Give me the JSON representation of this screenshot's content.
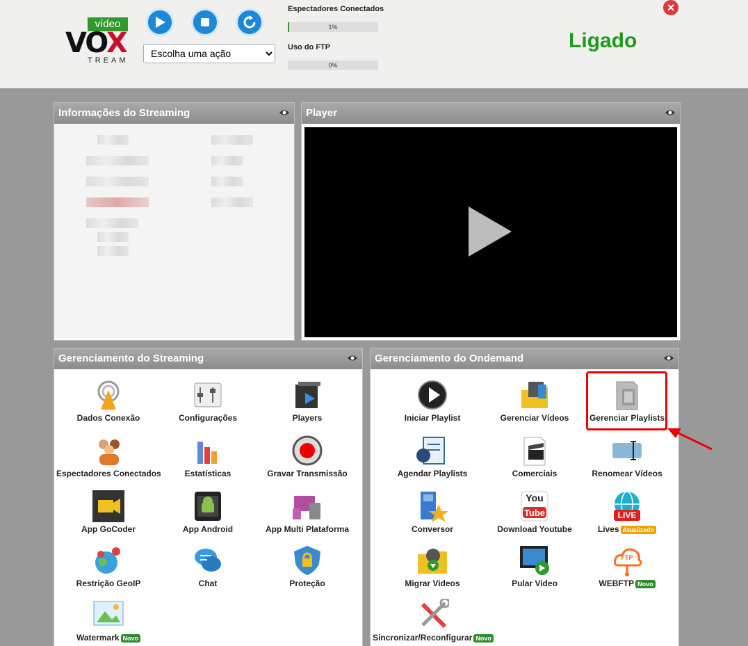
{
  "header": {
    "logo": {
      "badge": "vídeo",
      "word_a": "V",
      "word_o": "O",
      "word_x": "X",
      "sub": "TREAM"
    },
    "controls": {
      "play": "play-icon",
      "stop": "stop-icon",
      "restart": "restart-icon"
    },
    "action_select": {
      "selected": "Escolha uma ação"
    },
    "viewers": {
      "label": "Espectadores Conectados",
      "value": "1%",
      "fraction": 0.01
    },
    "ftp": {
      "label": "Uso do FTP",
      "value": "0%",
      "fraction": 0.0
    },
    "status": "Ligado",
    "close": "×"
  },
  "colors": {
    "accent": "#1e88d8",
    "status": "#1f9a1f",
    "close": "#d93a3a",
    "highlight": "#e00000"
  },
  "panels": {
    "info_title": "Informações do Streaming",
    "player_title": "Player",
    "streaming_title": "Gerenciamento do Streaming",
    "ondemand_title": "Gerenciamento do Ondemand"
  },
  "streaming_items": [
    {
      "label": "Dados Conexão",
      "icon": "antenna-icon"
    },
    {
      "label": "Configurações",
      "icon": "settings-sliders-icon"
    },
    {
      "label": "Players",
      "icon": "player-icon"
    },
    {
      "label": "Espectadores Conectados",
      "icon": "people-icon"
    },
    {
      "label": "Estatísticas",
      "icon": "bar-chart-icon"
    },
    {
      "label": "Gravar Transmissão",
      "icon": "record-icon"
    },
    {
      "label": "App GoCoder",
      "icon": "camera-app-icon"
    },
    {
      "label": "App Android",
      "icon": "android-icon"
    },
    {
      "label": "App Multi Plataforma",
      "icon": "multi-platform-icon"
    },
    {
      "label": "Restrição GeoIP",
      "icon": "globe-pin-icon"
    },
    {
      "label": "Chat",
      "icon": "chat-icon"
    },
    {
      "label": "Proteção",
      "icon": "shield-lock-icon"
    },
    {
      "label": "Watermark",
      "icon": "watermark-icon",
      "badge": "Novo"
    }
  ],
  "ondemand_items": [
    {
      "label": "Iniciar Playlist",
      "icon": "play-circle-icon"
    },
    {
      "label": "Gerenciar Vídeos",
      "icon": "video-folder-icon"
    },
    {
      "label": "Gerenciar Playlists",
      "icon": "film-playlist-icon"
    },
    {
      "label": "Agendar Playlists",
      "icon": "schedule-icon"
    },
    {
      "label": "Comerciais",
      "icon": "clapperboard-icon"
    },
    {
      "label": "Renomear Vídeos",
      "icon": "rename-icon"
    },
    {
      "label": "Conversor",
      "icon": "converter-icon"
    },
    {
      "label": "Download Youtube",
      "icon": "youtube-icon"
    },
    {
      "label": "Lives",
      "icon": "live-globe-icon",
      "badge": "Atualizado"
    },
    {
      "label": "Migrar Videos",
      "icon": "migrate-folder-icon"
    },
    {
      "label": "Pular Video",
      "icon": "skip-video-icon"
    },
    {
      "label": "WEBFTP",
      "icon": "ftp-cloud-icon",
      "badge": "Novo"
    },
    {
      "label": "Sincronizar/Reconfigurar",
      "icon": "tools-icon",
      "badge": "Novo"
    }
  ],
  "lives_sub": "LIVE",
  "youtube_sub": {
    "you": "You",
    "tube": "Tube"
  },
  "ftp_sub": "FTP"
}
